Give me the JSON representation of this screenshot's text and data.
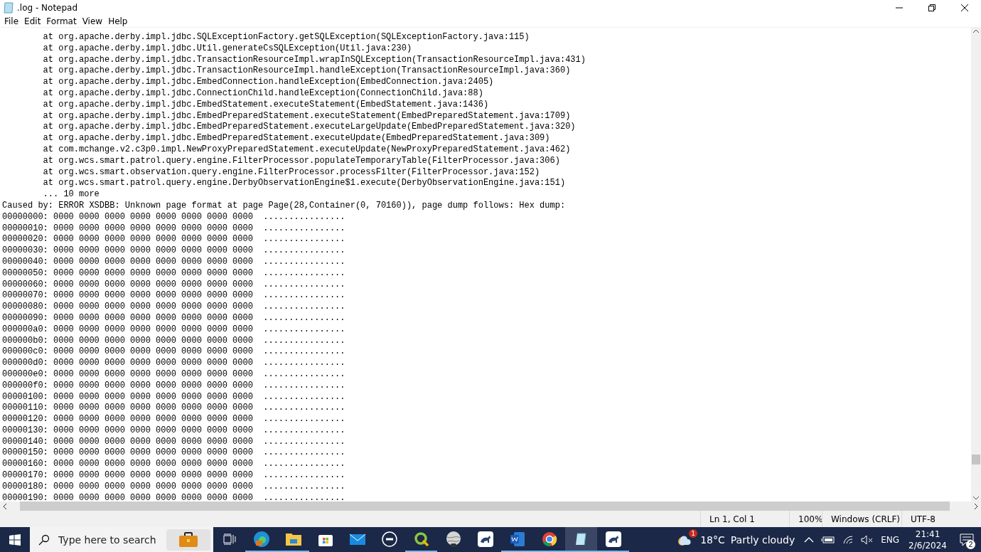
{
  "window": {
    "title": ".log - Notepad"
  },
  "menu": [
    "File",
    "Edit",
    "Format",
    "View",
    "Help"
  ],
  "editor": {
    "lines": [
      "\tat org.apache.derby.impl.jdbc.SQLExceptionFactory.getSQLException(SQLExceptionFactory.java:115)",
      "\tat org.apache.derby.impl.jdbc.Util.generateCsSQLException(Util.java:230)",
      "\tat org.apache.derby.impl.jdbc.TransactionResourceImpl.wrapInSQLException(TransactionResourceImpl.java:431)",
      "\tat org.apache.derby.impl.jdbc.TransactionResourceImpl.handleException(TransactionResourceImpl.java:360)",
      "\tat org.apache.derby.impl.jdbc.EmbedConnection.handleException(EmbedConnection.java:2405)",
      "\tat org.apache.derby.impl.jdbc.ConnectionChild.handleException(ConnectionChild.java:88)",
      "\tat org.apache.derby.impl.jdbc.EmbedStatement.executeStatement(EmbedStatement.java:1436)",
      "\tat org.apache.derby.impl.jdbc.EmbedPreparedStatement.executeStatement(EmbedPreparedStatement.java:1709)",
      "\tat org.apache.derby.impl.jdbc.EmbedPreparedStatement.executeLargeUpdate(EmbedPreparedStatement.java:320)",
      "\tat org.apache.derby.impl.jdbc.EmbedPreparedStatement.executeUpdate(EmbedPreparedStatement.java:309)",
      "\tat com.mchange.v2.c3p0.impl.NewProxyPreparedStatement.executeUpdate(NewProxyPreparedStatement.java:462)",
      "\tat org.wcs.smart.patrol.query.engine.FilterProcessor.populateTemporaryTable(FilterProcessor.java:306)",
      "\tat org.wcs.smart.observation.query.engine.FilterProcessor.processFilter(FilterProcessor.java:152)",
      "\tat org.wcs.smart.patrol.query.engine.DerbyObservationEngine$1.execute(DerbyObservationEngine.java:151)",
      "\t... 10 more",
      "Caused by: ERROR XSDBB: Unknown page format at page Page(28,Container(0, 70160)), page dump follows: Hex dump:",
      "00000000: 0000 0000 0000 0000 0000 0000 0000 0000  ................",
      "00000010: 0000 0000 0000 0000 0000 0000 0000 0000  ................",
      "00000020: 0000 0000 0000 0000 0000 0000 0000 0000  ................",
      "00000030: 0000 0000 0000 0000 0000 0000 0000 0000  ................",
      "00000040: 0000 0000 0000 0000 0000 0000 0000 0000  ................",
      "00000050: 0000 0000 0000 0000 0000 0000 0000 0000  ................",
      "00000060: 0000 0000 0000 0000 0000 0000 0000 0000  ................",
      "00000070: 0000 0000 0000 0000 0000 0000 0000 0000  ................",
      "00000080: 0000 0000 0000 0000 0000 0000 0000 0000  ................",
      "00000090: 0000 0000 0000 0000 0000 0000 0000 0000  ................",
      "000000a0: 0000 0000 0000 0000 0000 0000 0000 0000  ................",
      "000000b0: 0000 0000 0000 0000 0000 0000 0000 0000  ................",
      "000000c0: 0000 0000 0000 0000 0000 0000 0000 0000  ................",
      "000000d0: 0000 0000 0000 0000 0000 0000 0000 0000  ................",
      "000000e0: 0000 0000 0000 0000 0000 0000 0000 0000  ................",
      "000000f0: 0000 0000 0000 0000 0000 0000 0000 0000  ................",
      "00000100: 0000 0000 0000 0000 0000 0000 0000 0000  ................",
      "00000110: 0000 0000 0000 0000 0000 0000 0000 0000  ................",
      "00000120: 0000 0000 0000 0000 0000 0000 0000 0000  ................",
      "00000130: 0000 0000 0000 0000 0000 0000 0000 0000  ................",
      "00000140: 0000 0000 0000 0000 0000 0000 0000 0000  ................",
      "00000150: 0000 0000 0000 0000 0000 0000 0000 0000  ................",
      "00000160: 0000 0000 0000 0000 0000 0000 0000 0000  ................",
      "00000170: 0000 0000 0000 0000 0000 0000 0000 0000  ................",
      "00000180: 0000 0000 0000 0000 0000 0000 0000 0000  ................",
      "00000190: 0000 0000 0000 0000 0000 0000 0000 0000  ................"
    ]
  },
  "status_bar": [
    "Ln 1, Col 1",
    "100%",
    "Windows (CRLF)",
    "UTF-8"
  ],
  "taskbar": {
    "search": {
      "placeholder": "Type here to search"
    },
    "apps": [
      {
        "running": false,
        "selected": false
      },
      {
        "running": true,
        "selected": false
      },
      {
        "running": true,
        "selected": false
      },
      {
        "running": false,
        "selected": false
      },
      {
        "running": false,
        "selected": false
      },
      {
        "running": false,
        "selected": false
      },
      {
        "running": true,
        "selected": false
      },
      {
        "running": false,
        "selected": false
      },
      {
        "running": false,
        "selected": false
      },
      {
        "running": true,
        "selected": false
      },
      {
        "running": true,
        "selected": false
      },
      {
        "running": true,
        "selected": true
      },
      {
        "running": true,
        "selected": false
      }
    ],
    "weather": {
      "badge": "1",
      "temperature": "18°C",
      "condition": "Partly cloudy"
    },
    "language": "ENG",
    "time": "21:41",
    "date": "2/6/2024",
    "notifications": "2"
  }
}
